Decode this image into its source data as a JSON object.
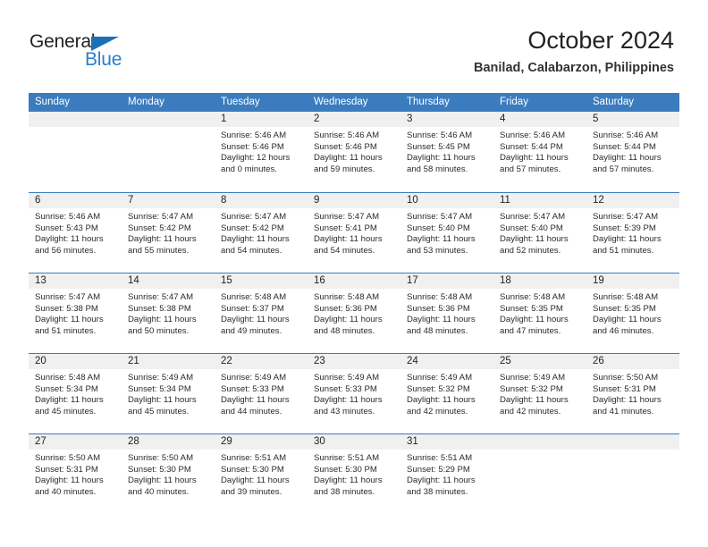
{
  "brand": {
    "name_top": "General",
    "name_bottom": "Blue",
    "accent_color": "#2a7fc9"
  },
  "header": {
    "title": "October 2024",
    "subtitle": "Banilad, Calabarzon, Philippines"
  },
  "theme": {
    "header_blue": "#3a7cbe",
    "daynum_gray": "#f0f0f0",
    "text": "#222222"
  },
  "weekday_headers": [
    "Sunday",
    "Monday",
    "Tuesday",
    "Wednesday",
    "Thursday",
    "Friday",
    "Saturday"
  ],
  "weeks": [
    [
      {
        "day": "",
        "sunrise": "",
        "sunset": "",
        "daylight_1": "",
        "daylight_2": ""
      },
      {
        "day": "",
        "sunrise": "",
        "sunset": "",
        "daylight_1": "",
        "daylight_2": ""
      },
      {
        "day": "1",
        "sunrise": "Sunrise: 5:46 AM",
        "sunset": "Sunset: 5:46 PM",
        "daylight_1": "Daylight: 12 hours",
        "daylight_2": "and 0 minutes."
      },
      {
        "day": "2",
        "sunrise": "Sunrise: 5:46 AM",
        "sunset": "Sunset: 5:46 PM",
        "daylight_1": "Daylight: 11 hours",
        "daylight_2": "and 59 minutes."
      },
      {
        "day": "3",
        "sunrise": "Sunrise: 5:46 AM",
        "sunset": "Sunset: 5:45 PM",
        "daylight_1": "Daylight: 11 hours",
        "daylight_2": "and 58 minutes."
      },
      {
        "day": "4",
        "sunrise": "Sunrise: 5:46 AM",
        "sunset": "Sunset: 5:44 PM",
        "daylight_1": "Daylight: 11 hours",
        "daylight_2": "and 57 minutes."
      },
      {
        "day": "5",
        "sunrise": "Sunrise: 5:46 AM",
        "sunset": "Sunset: 5:44 PM",
        "daylight_1": "Daylight: 11 hours",
        "daylight_2": "and 57 minutes."
      }
    ],
    [
      {
        "day": "6",
        "sunrise": "Sunrise: 5:46 AM",
        "sunset": "Sunset: 5:43 PM",
        "daylight_1": "Daylight: 11 hours",
        "daylight_2": "and 56 minutes."
      },
      {
        "day": "7",
        "sunrise": "Sunrise: 5:47 AM",
        "sunset": "Sunset: 5:42 PM",
        "daylight_1": "Daylight: 11 hours",
        "daylight_2": "and 55 minutes."
      },
      {
        "day": "8",
        "sunrise": "Sunrise: 5:47 AM",
        "sunset": "Sunset: 5:42 PM",
        "daylight_1": "Daylight: 11 hours",
        "daylight_2": "and 54 minutes."
      },
      {
        "day": "9",
        "sunrise": "Sunrise: 5:47 AM",
        "sunset": "Sunset: 5:41 PM",
        "daylight_1": "Daylight: 11 hours",
        "daylight_2": "and 54 minutes."
      },
      {
        "day": "10",
        "sunrise": "Sunrise: 5:47 AM",
        "sunset": "Sunset: 5:40 PM",
        "daylight_1": "Daylight: 11 hours",
        "daylight_2": "and 53 minutes."
      },
      {
        "day": "11",
        "sunrise": "Sunrise: 5:47 AM",
        "sunset": "Sunset: 5:40 PM",
        "daylight_1": "Daylight: 11 hours",
        "daylight_2": "and 52 minutes."
      },
      {
        "day": "12",
        "sunrise": "Sunrise: 5:47 AM",
        "sunset": "Sunset: 5:39 PM",
        "daylight_1": "Daylight: 11 hours",
        "daylight_2": "and 51 minutes."
      }
    ],
    [
      {
        "day": "13",
        "sunrise": "Sunrise: 5:47 AM",
        "sunset": "Sunset: 5:38 PM",
        "daylight_1": "Daylight: 11 hours",
        "daylight_2": "and 51 minutes."
      },
      {
        "day": "14",
        "sunrise": "Sunrise: 5:47 AM",
        "sunset": "Sunset: 5:38 PM",
        "daylight_1": "Daylight: 11 hours",
        "daylight_2": "and 50 minutes."
      },
      {
        "day": "15",
        "sunrise": "Sunrise: 5:48 AM",
        "sunset": "Sunset: 5:37 PM",
        "daylight_1": "Daylight: 11 hours",
        "daylight_2": "and 49 minutes."
      },
      {
        "day": "16",
        "sunrise": "Sunrise: 5:48 AM",
        "sunset": "Sunset: 5:36 PM",
        "daylight_1": "Daylight: 11 hours",
        "daylight_2": "and 48 minutes."
      },
      {
        "day": "17",
        "sunrise": "Sunrise: 5:48 AM",
        "sunset": "Sunset: 5:36 PM",
        "daylight_1": "Daylight: 11 hours",
        "daylight_2": "and 48 minutes."
      },
      {
        "day": "18",
        "sunrise": "Sunrise: 5:48 AM",
        "sunset": "Sunset: 5:35 PM",
        "daylight_1": "Daylight: 11 hours",
        "daylight_2": "and 47 minutes."
      },
      {
        "day": "19",
        "sunrise": "Sunrise: 5:48 AM",
        "sunset": "Sunset: 5:35 PM",
        "daylight_1": "Daylight: 11 hours",
        "daylight_2": "and 46 minutes."
      }
    ],
    [
      {
        "day": "20",
        "sunrise": "Sunrise: 5:48 AM",
        "sunset": "Sunset: 5:34 PM",
        "daylight_1": "Daylight: 11 hours",
        "daylight_2": "and 45 minutes."
      },
      {
        "day": "21",
        "sunrise": "Sunrise: 5:49 AM",
        "sunset": "Sunset: 5:34 PM",
        "daylight_1": "Daylight: 11 hours",
        "daylight_2": "and 45 minutes."
      },
      {
        "day": "22",
        "sunrise": "Sunrise: 5:49 AM",
        "sunset": "Sunset: 5:33 PM",
        "daylight_1": "Daylight: 11 hours",
        "daylight_2": "and 44 minutes."
      },
      {
        "day": "23",
        "sunrise": "Sunrise: 5:49 AM",
        "sunset": "Sunset: 5:33 PM",
        "daylight_1": "Daylight: 11 hours",
        "daylight_2": "and 43 minutes."
      },
      {
        "day": "24",
        "sunrise": "Sunrise: 5:49 AM",
        "sunset": "Sunset: 5:32 PM",
        "daylight_1": "Daylight: 11 hours",
        "daylight_2": "and 42 minutes."
      },
      {
        "day": "25",
        "sunrise": "Sunrise: 5:49 AM",
        "sunset": "Sunset: 5:32 PM",
        "daylight_1": "Daylight: 11 hours",
        "daylight_2": "and 42 minutes."
      },
      {
        "day": "26",
        "sunrise": "Sunrise: 5:50 AM",
        "sunset": "Sunset: 5:31 PM",
        "daylight_1": "Daylight: 11 hours",
        "daylight_2": "and 41 minutes."
      }
    ],
    [
      {
        "day": "27",
        "sunrise": "Sunrise: 5:50 AM",
        "sunset": "Sunset: 5:31 PM",
        "daylight_1": "Daylight: 11 hours",
        "daylight_2": "and 40 minutes."
      },
      {
        "day": "28",
        "sunrise": "Sunrise: 5:50 AM",
        "sunset": "Sunset: 5:30 PM",
        "daylight_1": "Daylight: 11 hours",
        "daylight_2": "and 40 minutes."
      },
      {
        "day": "29",
        "sunrise": "Sunrise: 5:51 AM",
        "sunset": "Sunset: 5:30 PM",
        "daylight_1": "Daylight: 11 hours",
        "daylight_2": "and 39 minutes."
      },
      {
        "day": "30",
        "sunrise": "Sunrise: 5:51 AM",
        "sunset": "Sunset: 5:30 PM",
        "daylight_1": "Daylight: 11 hours",
        "daylight_2": "and 38 minutes."
      },
      {
        "day": "31",
        "sunrise": "Sunrise: 5:51 AM",
        "sunset": "Sunset: 5:29 PM",
        "daylight_1": "Daylight: 11 hours",
        "daylight_2": "and 38 minutes."
      },
      {
        "day": "",
        "sunrise": "",
        "sunset": "",
        "daylight_1": "",
        "daylight_2": ""
      },
      {
        "day": "",
        "sunrise": "",
        "sunset": "",
        "daylight_1": "",
        "daylight_2": ""
      }
    ]
  ]
}
